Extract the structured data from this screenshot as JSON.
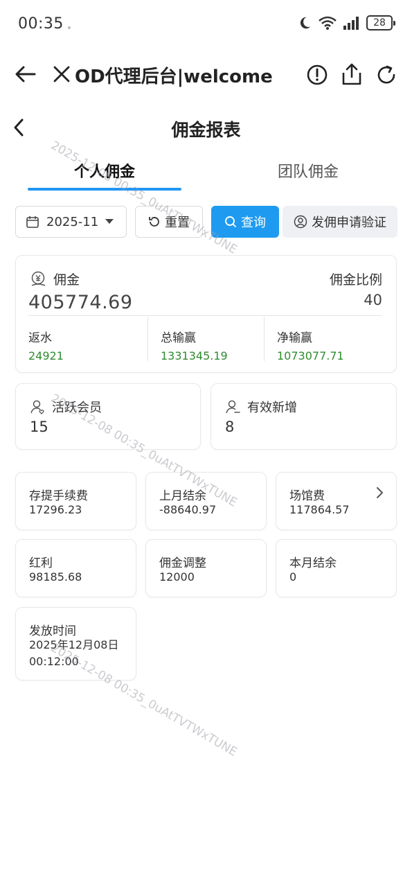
{
  "status_bar": {
    "time": "00:35",
    "battery": "28"
  },
  "browser": {
    "title": "OD代理后台|welcome"
  },
  "page": {
    "title": "佣金报表"
  },
  "tabs": [
    {
      "label": "个人佣金",
      "active": true
    },
    {
      "label": "团队佣金",
      "active": false
    }
  ],
  "filters": {
    "date": "2025-11",
    "reset_label": "重置",
    "query_label": "查询",
    "verify_label": "发佣申请验证",
    "accent_color": "#1e9bf0"
  },
  "commission": {
    "label": "佣金",
    "value": "405774.69",
    "ratio_label": "佣金比例",
    "ratio_value": "40",
    "stats": [
      {
        "label": "返水",
        "value": "24921"
      },
      {
        "label": "总输赢",
        "value": "1331345.19"
      },
      {
        "label": "净输赢",
        "value": "1073077.71"
      }
    ],
    "stat_color": "#2e8b2e"
  },
  "members": [
    {
      "label": "活跃会员",
      "value": "15"
    },
    {
      "label": "有效新增",
      "value": "8"
    }
  ],
  "details": [
    {
      "label": "存提手续费",
      "value": "17296.23"
    },
    {
      "label": "上月结余",
      "value": "-88640.97"
    },
    {
      "label": "场馆费",
      "value": "117864.57"
    },
    {
      "label": "红利",
      "value": "98185.68"
    },
    {
      "label": "佣金调整",
      "value": "12000"
    },
    {
      "label": "本月结余",
      "value": "0"
    }
  ],
  "release": {
    "label": "发放时间",
    "date": "2025年12月08日",
    "time": "00:12:00"
  },
  "watermark": "2025-12-08 00:35_0uAtTVTWxTUNE"
}
